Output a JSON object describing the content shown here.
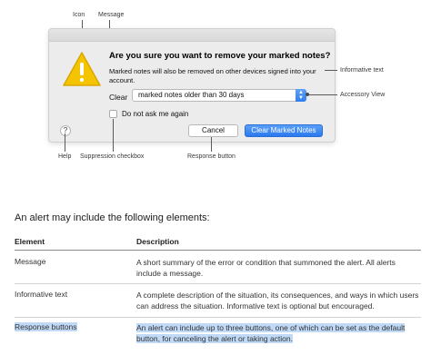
{
  "callouts": {
    "icon": "Icon",
    "message": "Message",
    "informative_text": "Informative text",
    "accessory_view": "Accessory View",
    "help": "Help",
    "suppression_checkbox": "Suppression checkbox",
    "response_button": "Response button"
  },
  "alert": {
    "message": "Are you sure you want to remove your marked notes?",
    "informative_text": "Marked notes will also be removed on other devices signed into your account.",
    "accessory_label": "Clear",
    "accessory_select_value": "marked notes older than 30 days",
    "checkbox_label": "Do not ask me again",
    "help_glyph": "?",
    "cancel_label": "Cancel",
    "default_label": "Clear Marked Notes",
    "accent_color": "#2f7df0"
  },
  "section": {
    "heading": "An alert may include the following elements:"
  },
  "table": {
    "headers": [
      "Element",
      "Description"
    ],
    "rows": [
      {
        "element": "Message",
        "description": "A short summary of the error or condition that summoned the alert. All alerts include a message."
      },
      {
        "element": "Informative text",
        "description": "A complete description of the situation, its consequences, and ways in which users can address the situation. Informative text is optional but encouraged."
      },
      {
        "element": "Response buttons",
        "description": "An alert can include up to three buttons, one of which can be set as the default button, for canceling the alert or taking action."
      }
    ],
    "highlight_color": "#c0d9f6"
  }
}
